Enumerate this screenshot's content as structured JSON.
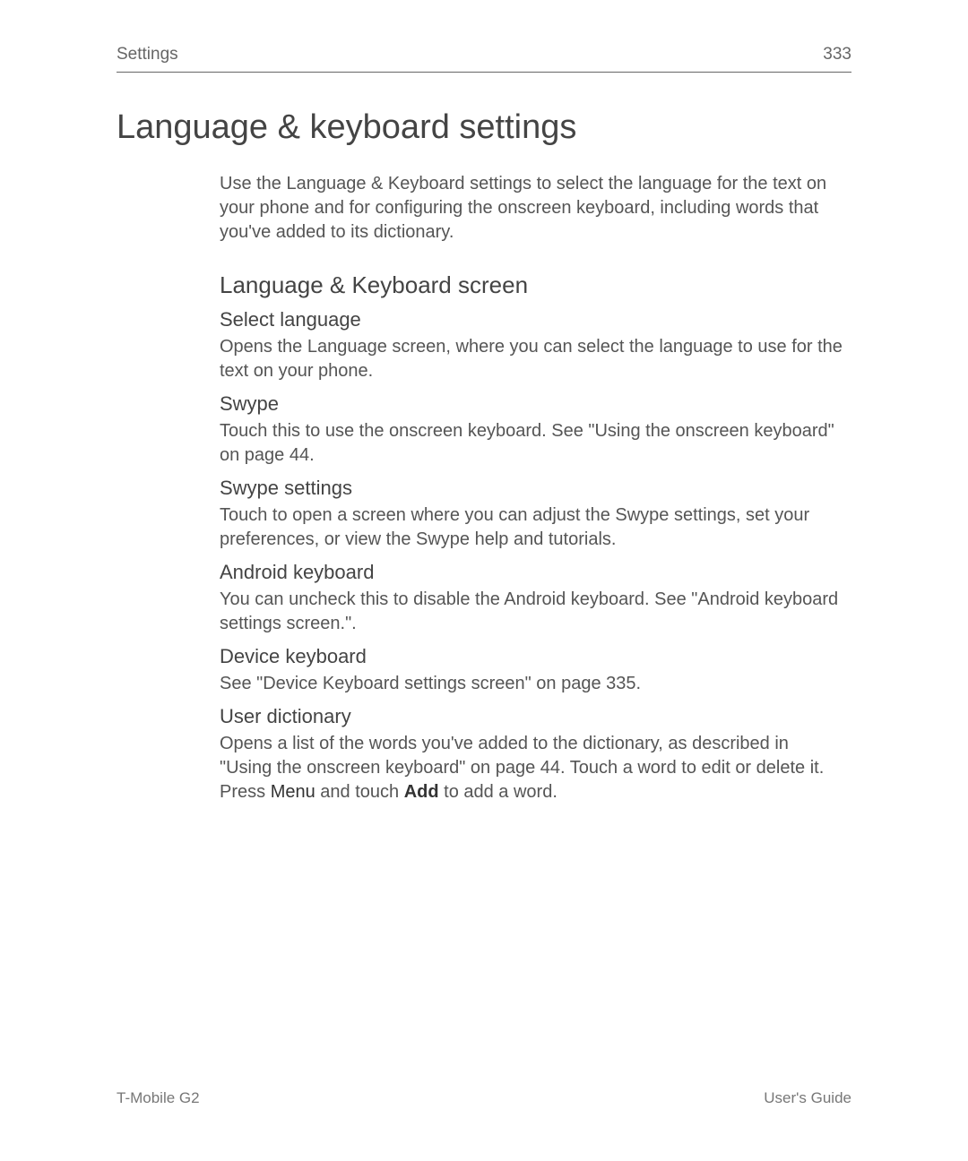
{
  "header": {
    "left": "Settings",
    "right": "333"
  },
  "main_title": "Language & keyboard settings",
  "intro": "Use the Language & Keyboard settings to select the language for the text on your phone and for configuring the onscreen keyboard, including words that you've added to its dictionary.",
  "section_title": "Language & Keyboard screen",
  "items": [
    {
      "title": "Select language",
      "body": "Opens the Language screen, where you can select the language to use for the text on your phone."
    },
    {
      "title": "Swype",
      "body": "Touch this to use the onscreen keyboard. See \"Using the onscreen keyboard\" on page 44."
    },
    {
      "title": "Swype settings",
      "body": "Touch to open a screen where you can adjust the Swype settings, set your preferences, or view the Swype help and tutorials."
    },
    {
      "title": "Android keyboard",
      "body": "You can uncheck this to disable the Android keyboard. See \"Android keyboard settings screen.\"."
    },
    {
      "title": "Device keyboard",
      "body": "See \"Device Keyboard settings screen\" on page 335."
    },
    {
      "title": "User dictionary",
      "body_pre": "Opens a list of the words you've added to the dictionary, as described in \"Using the onscreen keyboard\" on page 44. Touch a word to edit or delete it. Press ",
      "menu": "Menu",
      "body_mid": " and touch ",
      "add": "Add",
      "body_post": " to add a word."
    }
  ],
  "footer": {
    "left": "T-Mobile G2",
    "right": "User's Guide"
  }
}
